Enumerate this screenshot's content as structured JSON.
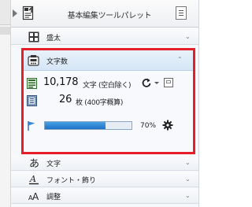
{
  "palette": {
    "title": "基本編集ツールパレット",
    "menu_icon": "hamburger-menu-icon",
    "doc_icon": "document-icon"
  },
  "rows_top": [
    {
      "label": "盛太",
      "icon": "grid-icon",
      "chevron": "⌄"
    }
  ],
  "word_count": {
    "label": "文字数",
    "icon": "counter-icon",
    "chevron": "⌃",
    "char_count": "10,178",
    "char_unit": "文字 (空白除く)",
    "page_count": "26",
    "page_unit": "枚 (400字概算)",
    "progress_fraction": 0.7,
    "progress_label": "70%",
    "accent_color": "#1f72c4",
    "highlight_color": "#e61e2a"
  },
  "rows_bottom": [
    {
      "label": "文字",
      "icon": "hiragana-a-icon",
      "chevron": "⌄"
    },
    {
      "label": "フォント・飾り",
      "icon": "underline-a-icon",
      "chevron": "⌄"
    },
    {
      "label": "調整",
      "icon": "text-size-icon",
      "chevron": "⌄"
    }
  ]
}
